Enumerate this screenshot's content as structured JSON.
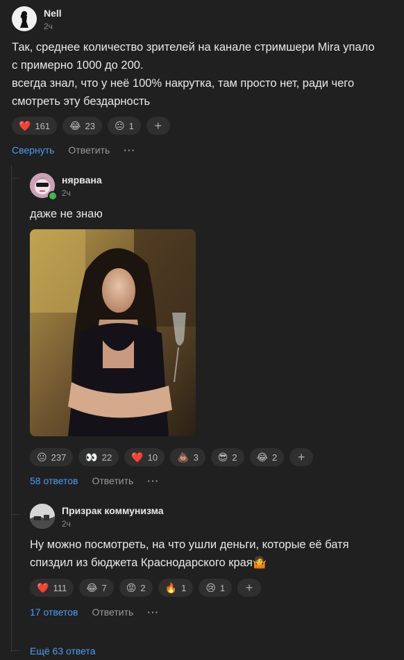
{
  "comment1": {
    "author": "Nell",
    "time": "2ч",
    "text_line1": "Так, среднее количество зрителей на канале стримшери Mira упало",
    "text_line2": "с примерно 1000 до 200.",
    "text_line3": "всегда знал, что у неё 100% накрутка, там просто нет, ради чего",
    "text_line4": "смотреть эту бездарность",
    "reactions": [
      {
        "emoji": "❤️",
        "count": "161"
      },
      {
        "emoji": "😂",
        "count": "23"
      },
      {
        "emoji": "😐",
        "count": "1"
      }
    ],
    "add_label": "+",
    "collapse_label": "Свернуть",
    "reply_label": "Ответить",
    "more_label": "···"
  },
  "reply1": {
    "author": "нярвана",
    "time": "2ч",
    "text": "даже не знаю",
    "reactions": [
      {
        "emoji": "😐",
        "count": "237"
      },
      {
        "emoji": "👀",
        "count": "22"
      },
      {
        "emoji": "❤️",
        "count": "10"
      },
      {
        "emoji": "💩",
        "count": "3"
      },
      {
        "emoji": "😎",
        "count": "2"
      },
      {
        "emoji": "😂",
        "count": "2"
      }
    ],
    "add_label": "+",
    "replies_label": "58 ответов",
    "reply_label": "Ответить",
    "more_label": "···"
  },
  "reply2": {
    "author": "Призрак коммунизма",
    "time": "2ч",
    "text_line1": "Ну можно посмотреть, на что ушли деньги, которые её батя",
    "text_line2": "спиздил из бюджета Краснодарского края🤷",
    "reactions": [
      {
        "emoji": "❤️",
        "count": "111"
      },
      {
        "emoji": "😂",
        "count": "7"
      },
      {
        "emoji": "😡",
        "count": "2"
      },
      {
        "emoji": "🔥",
        "count": "1"
      },
      {
        "emoji": "😢",
        "count": "1"
      }
    ],
    "add_label": "+",
    "replies_label": "17 ответов",
    "reply_label": "Ответить",
    "more_label": "···"
  },
  "more_replies_label": "Ещё 63 ответа",
  "colors": {
    "background": "#202020",
    "link": "#4e9cf5",
    "pill": "#2f2f2f",
    "online": "#3fb950"
  }
}
